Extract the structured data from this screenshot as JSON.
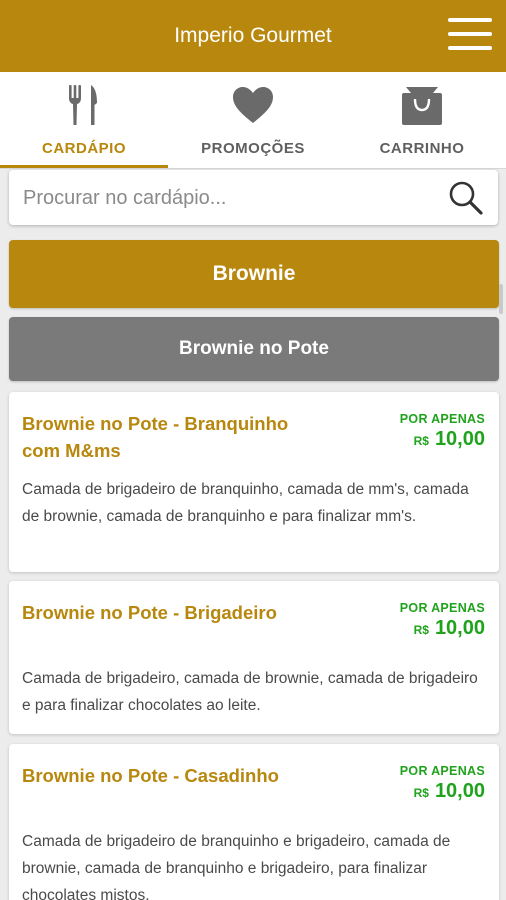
{
  "header": {
    "title": "Imperio Gourmet",
    "menu_icon": "hamburger-menu-icon"
  },
  "tabs": [
    {
      "label": "CARDÁPIO",
      "icon": "fork-knife-icon",
      "active": true
    },
    {
      "label": "PROMOÇÕES",
      "icon": "heart-icon",
      "active": false
    },
    {
      "label": "CARRINHO",
      "icon": "shopping-bag-icon",
      "active": false
    }
  ],
  "search": {
    "placeholder": "Procurar no cardápio...",
    "icon": "search-icon"
  },
  "category": {
    "main": "Brownie",
    "sub": "Brownie no Pote"
  },
  "colors": {
    "brand": "#b8870d",
    "sub_category": "#7a7a7a",
    "price": "#20a31c"
  },
  "products": [
    {
      "name": "Brownie no Pote - Branquinho com M&ms",
      "price_label": "POR APENAS",
      "currency": "R$",
      "price": "10,00",
      "description": "Camada de brigadeiro de branquinho, camada de mm's, camada de brownie, camada de branquinho e para finalizar mm's."
    },
    {
      "name": "Brownie no Pote - Brigadeiro",
      "price_label": "POR APENAS",
      "currency": "R$",
      "price": "10,00",
      "description": "Camada de brigadeiro, camada de brownie, camada de brigadeiro e para finalizar chocolates ao leite."
    },
    {
      "name": "Brownie no Pote - Casadinho",
      "price_label": "POR APENAS",
      "currency": "R$",
      "price": "10,00",
      "description": "Camada de brigadeiro de branquinho e brigadeiro, camada de brownie, camada de branquinho e brigadeiro, para finalizar chocolates mistos."
    }
  ]
}
